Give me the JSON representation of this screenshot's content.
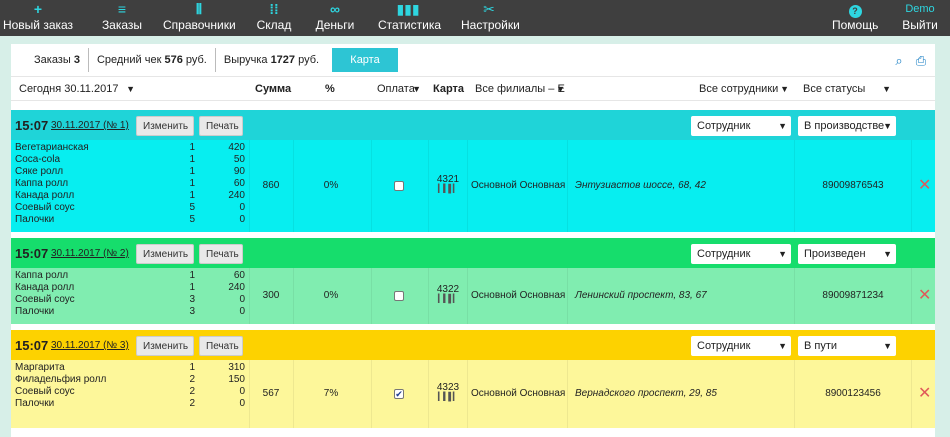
{
  "nav": {
    "items": [
      {
        "label": "Новый заказ",
        "icon": "plus-icon"
      },
      {
        "label": "Заказы",
        "icon": "menu-icon"
      },
      {
        "label": "Справочники",
        "icon": "books-icon"
      },
      {
        "label": "Склад",
        "icon": "grid-icon"
      },
      {
        "label": "Деньги",
        "icon": "money-icon"
      },
      {
        "label": "Статистика",
        "icon": "chart-icon"
      },
      {
        "label": "Настройки",
        "icon": "settings-icon"
      }
    ],
    "help_label": "Помощь",
    "user_label": "Demo",
    "logout_label": "Выйти"
  },
  "summary": {
    "orders_label": "Заказы",
    "orders_value": "3",
    "avg_label": "Средний чек",
    "avg_value": "576",
    "avg_unit": "руб.",
    "revenue_label": "Выручка",
    "revenue_value": "1727",
    "revenue_unit": "руб.",
    "map_button": "Карта"
  },
  "filters": {
    "date": "Сегодня 30.11.2017",
    "sum_header": "Сумма",
    "percent_header": "%",
    "payment": "Оплата",
    "card_header": "Карта",
    "branches": "Все филиалы – Е",
    "employees": "Все сотрудники",
    "statuses": "Все статусы"
  },
  "colors": {
    "nav_bg": "#3f3f3f",
    "accent": "#2ed6e0",
    "order1_head": "#1fd4d8",
    "order1_body": "#07eef0",
    "order2_head": "#16dd6c",
    "order2_body": "#80edb0",
    "order3_head": "#fdd200",
    "order3_body": "#fdf79a"
  },
  "orders": [
    {
      "time": "15:07",
      "date": "30.11.2017 (№ 1)",
      "edit_label": "Изменить",
      "print_label": "Печать",
      "employee": "Сотрудник",
      "status": "В производстве",
      "items": [
        {
          "name": "Вегетарианская",
          "qty": "1",
          "price": "420"
        },
        {
          "name": "Coca-cola",
          "qty": "1",
          "price": "50"
        },
        {
          "name": "Сяке ролл",
          "qty": "1",
          "price": "90"
        },
        {
          "name": "Каппа ролл",
          "qty": "1",
          "price": "60"
        },
        {
          "name": "Канада ролл",
          "qty": "1",
          "price": "240"
        },
        {
          "name": "Соевый соус",
          "qty": "5",
          "price": "0"
        },
        {
          "name": "Палочки",
          "qty": "5",
          "price": "0"
        }
      ],
      "sum": "860",
      "percent": "0%",
      "paid": false,
      "card": "4321",
      "branch": "Основной Основная",
      "address": "Энтузиастов шоссе, 68, 42",
      "phone": "89009876543"
    },
    {
      "time": "15:07",
      "date": "30.11.2017 (№ 2)",
      "edit_label": "Изменить",
      "print_label": "Печать",
      "employee": "Сотрудник",
      "status": "Произведен",
      "items": [
        {
          "name": "Каппа ролл",
          "qty": "1",
          "price": "60"
        },
        {
          "name": "Канада ролл",
          "qty": "1",
          "price": "240"
        },
        {
          "name": "Соевый соус",
          "qty": "3",
          "price": "0"
        },
        {
          "name": "Палочки",
          "qty": "3",
          "price": "0"
        }
      ],
      "sum": "300",
      "percent": "0%",
      "paid": false,
      "card": "4322",
      "branch": "Основной Основная",
      "address": "Ленинский проспект, 83, 67",
      "phone": "89009871234"
    },
    {
      "time": "15:07",
      "date": "30.11.2017 (№ 3)",
      "edit_label": "Изменить",
      "print_label": "Печать",
      "employee": "Сотрудник",
      "status": "В пути",
      "items": [
        {
          "name": "Маргарита",
          "qty": "1",
          "price": "310"
        },
        {
          "name": "Филадельфия ролл",
          "qty": "2",
          "price": "150"
        },
        {
          "name": "Соевый соус",
          "qty": "2",
          "price": "0"
        },
        {
          "name": "Палочки",
          "qty": "2",
          "price": "0"
        }
      ],
      "sum": "567",
      "percent": "7%",
      "paid": true,
      "card": "4323",
      "branch": "Основной Основная",
      "address": "Вернадского проспект, 29, 85",
      "phone": "8900123456"
    }
  ]
}
